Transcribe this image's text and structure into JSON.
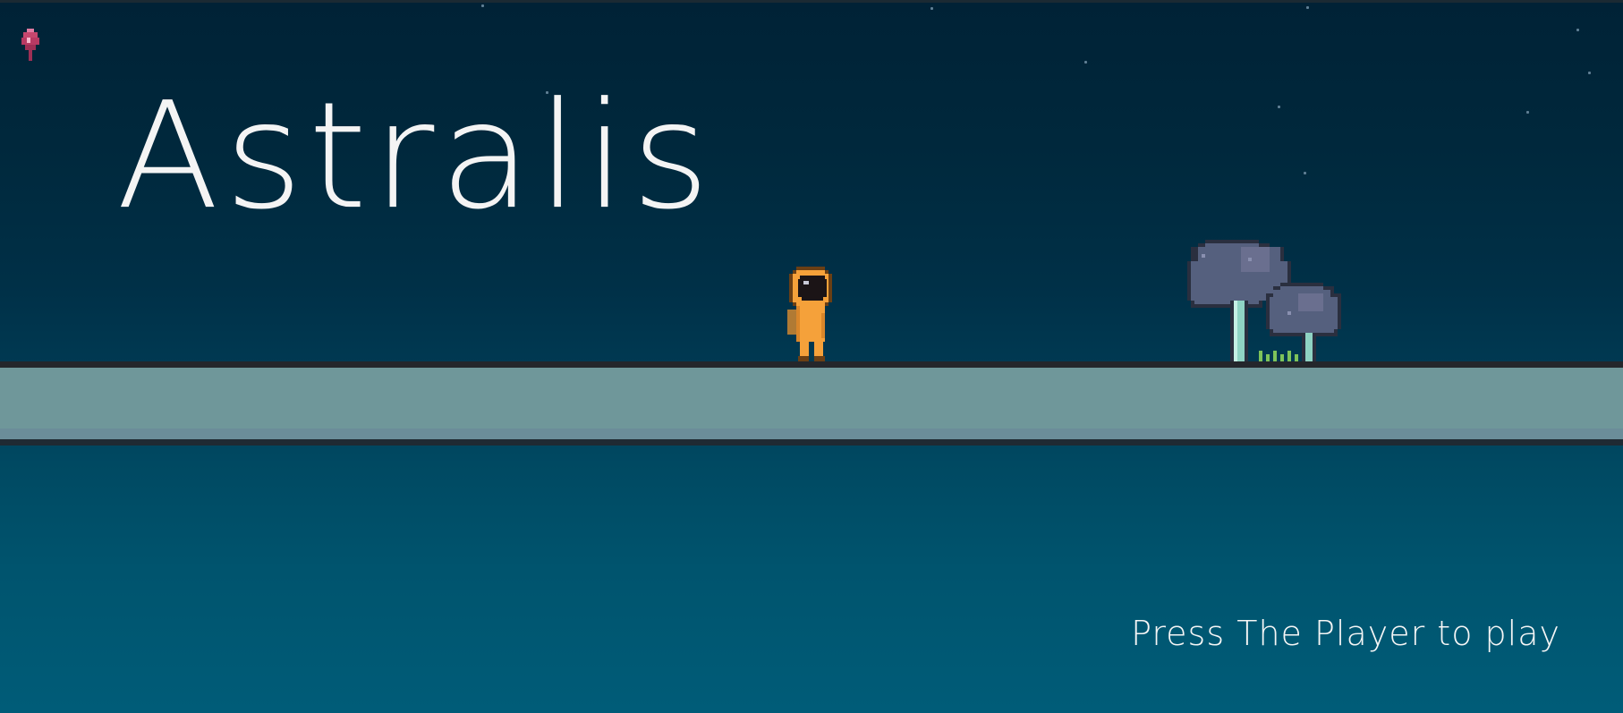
{
  "game": {
    "title": "Astralis",
    "prompt": "Press The Player to play"
  },
  "icons": {
    "corner_icon": "pink-crystal-icon",
    "player": "astronaut-player-sprite",
    "scenery": "mushroom-trees"
  },
  "colors": {
    "sky_top": "#002236",
    "sky_bottom": "#005c78",
    "platform": "#6f979a",
    "platform_edge": "#24262b",
    "player_suit": "#f5a13a",
    "player_visor": "#1b1416",
    "tree_canopy": "#55607e",
    "tree_trunk": "#8fd3c3",
    "corner_icon": "#c5476e",
    "text": "#f4f4f4"
  }
}
